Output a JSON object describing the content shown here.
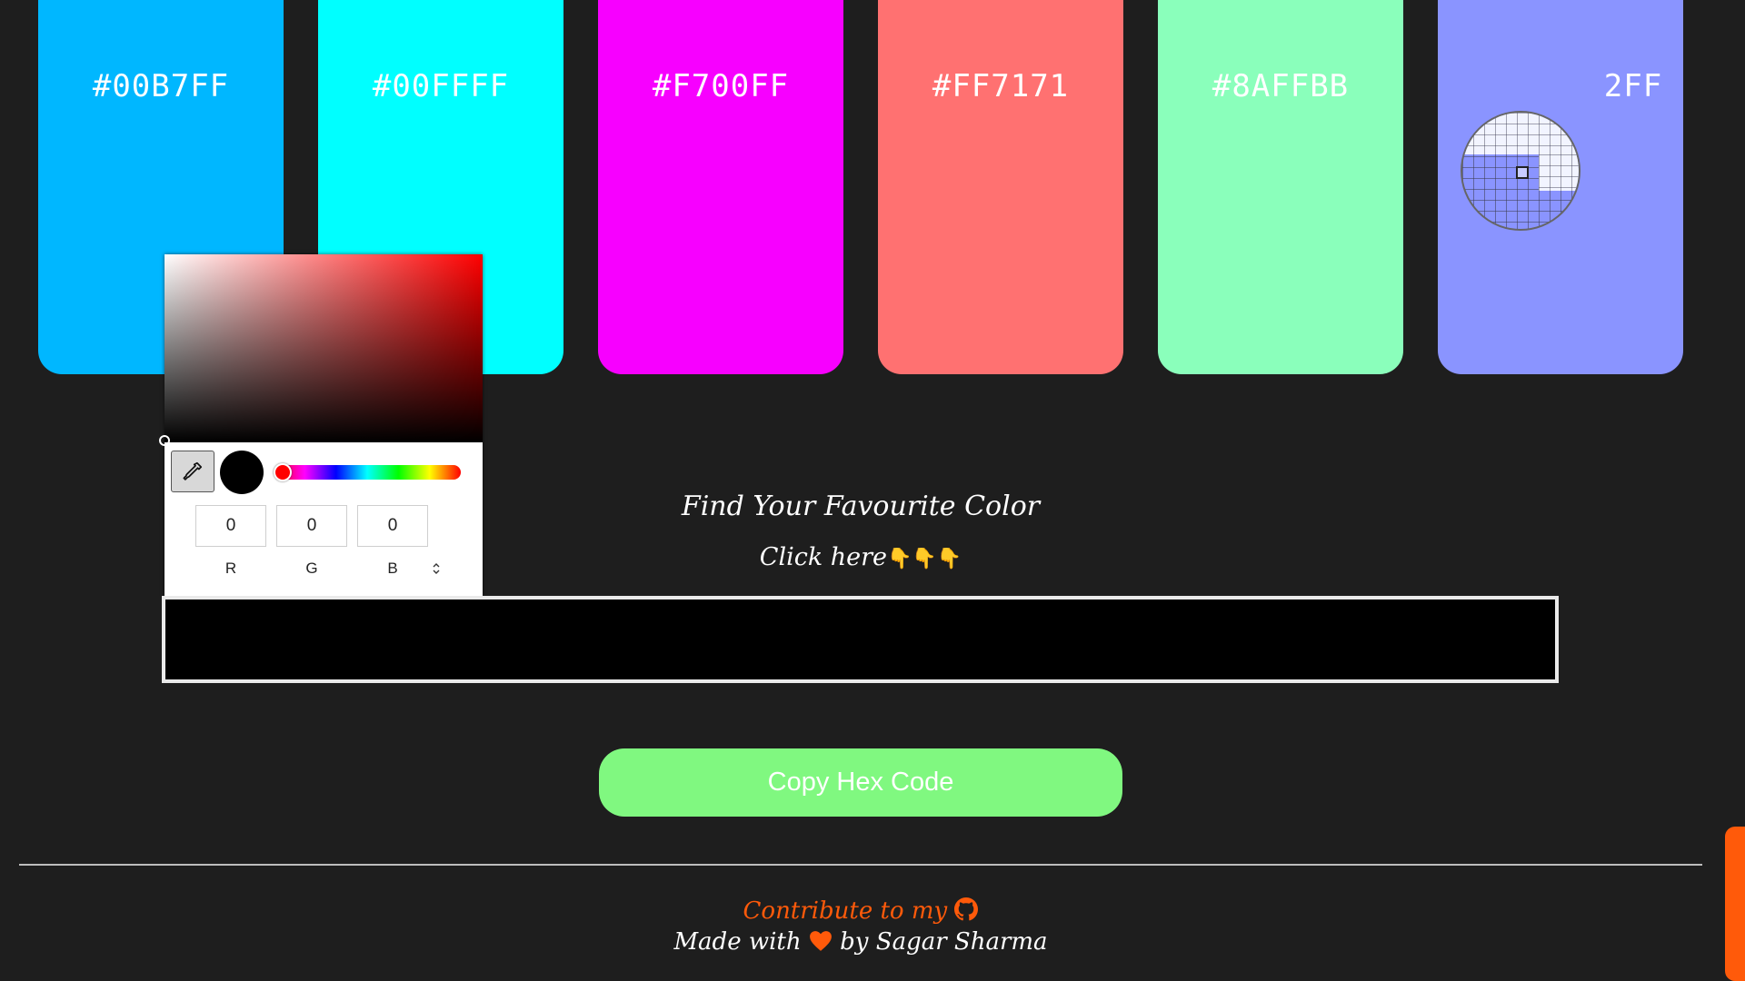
{
  "swatches": [
    {
      "hex": "#00B7FF",
      "label": "#00B7FF"
    },
    {
      "hex": "#00FFFF",
      "label": "#00FFFF"
    },
    {
      "hex": "#F700FF",
      "label": "#F700FF"
    },
    {
      "hex": "#FF7171",
      "label": "#FF7171"
    },
    {
      "hex": "#8AFFBB",
      "label": "#8AFFBB"
    },
    {
      "hex": "#8A94FF",
      "label": "2FF"
    }
  ],
  "picker": {
    "r": "0",
    "g": "0",
    "b": "0",
    "r_label": "R",
    "g_label": "G",
    "b_label": "B",
    "hue_color": "#FF0000",
    "mode_toggle_glyph": "⌃⌄"
  },
  "main": {
    "heading": "Find Your Favourite Color",
    "subheading": "Click here",
    "pointing_emojis": "👇👇👇",
    "selected_color": "#000000",
    "copy_button": "Copy Hex Code"
  },
  "footer": {
    "contribute_text": "Contribute to my",
    "made_with": "Made with",
    "by": "by Sagar Sharma",
    "accent_color": "#FF5A0A"
  }
}
